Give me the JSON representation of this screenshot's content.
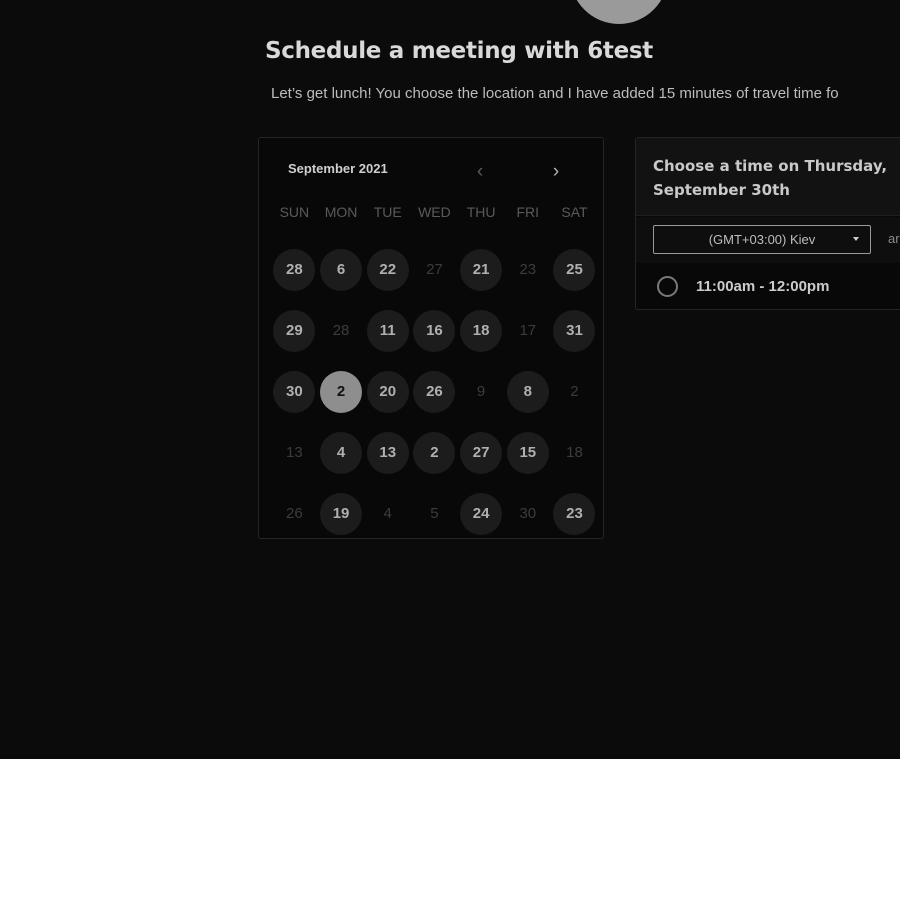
{
  "header": {
    "title": "Schedule a meeting with 6test",
    "subtitle": "Let’s get lunch! You choose the location and I have added 15 minutes of travel time fo"
  },
  "calendar": {
    "month_label": "September 2021",
    "prev_icon": "‹",
    "next_icon": "›",
    "weekdays": [
      "SUN",
      "MON",
      "TUE",
      "WED",
      "THU",
      "FRI",
      "SAT"
    ],
    "weeks": [
      [
        {
          "d": "28",
          "s": "avail"
        },
        {
          "d": "6",
          "s": "avail"
        },
        {
          "d": "22",
          "s": "avail"
        },
        {
          "d": "27",
          "s": "unavail"
        },
        {
          "d": "21",
          "s": "avail"
        },
        {
          "d": "23",
          "s": "unavail"
        },
        {
          "d": "25",
          "s": "avail"
        }
      ],
      [
        {
          "d": "29",
          "s": "avail"
        },
        {
          "d": "28",
          "s": "unavail"
        },
        {
          "d": "11",
          "s": "avail"
        },
        {
          "d": "16",
          "s": "avail"
        },
        {
          "d": "18",
          "s": "avail"
        },
        {
          "d": "17",
          "s": "unavail"
        },
        {
          "d": "31",
          "s": "avail"
        }
      ],
      [
        {
          "d": "30",
          "s": "avail"
        },
        {
          "d": "2",
          "s": "selected"
        },
        {
          "d": "20",
          "s": "avail"
        },
        {
          "d": "26",
          "s": "avail"
        },
        {
          "d": "9",
          "s": "unavail"
        },
        {
          "d": "8",
          "s": "avail"
        },
        {
          "d": "2",
          "s": "unavail"
        }
      ],
      [
        {
          "d": "13",
          "s": "unavail"
        },
        {
          "d": "4",
          "s": "avail"
        },
        {
          "d": "13",
          "s": "avail"
        },
        {
          "d": "2",
          "s": "avail"
        },
        {
          "d": "27",
          "s": "avail"
        },
        {
          "d": "15",
          "s": "avail"
        },
        {
          "d": "18",
          "s": "unavail"
        }
      ],
      [
        {
          "d": "26",
          "s": "unavail"
        },
        {
          "d": "19",
          "s": "avail"
        },
        {
          "d": "4",
          "s": "unavail"
        },
        {
          "d": "5",
          "s": "unavail"
        },
        {
          "d": "24",
          "s": "avail"
        },
        {
          "d": "30",
          "s": "unavail"
        },
        {
          "d": "23",
          "s": "avail"
        }
      ]
    ]
  },
  "time_panel": {
    "header": "Choose a time on Thursday, September 30th",
    "timezone": "(GMT+03:00) Kiev",
    "extra_label": "ar",
    "slot": "11:00am - 12:00pm"
  },
  "colors": {
    "background": "#0b0b0b",
    "selected_day": "#8e8e8e",
    "available_day": "#1c1c1c"
  }
}
